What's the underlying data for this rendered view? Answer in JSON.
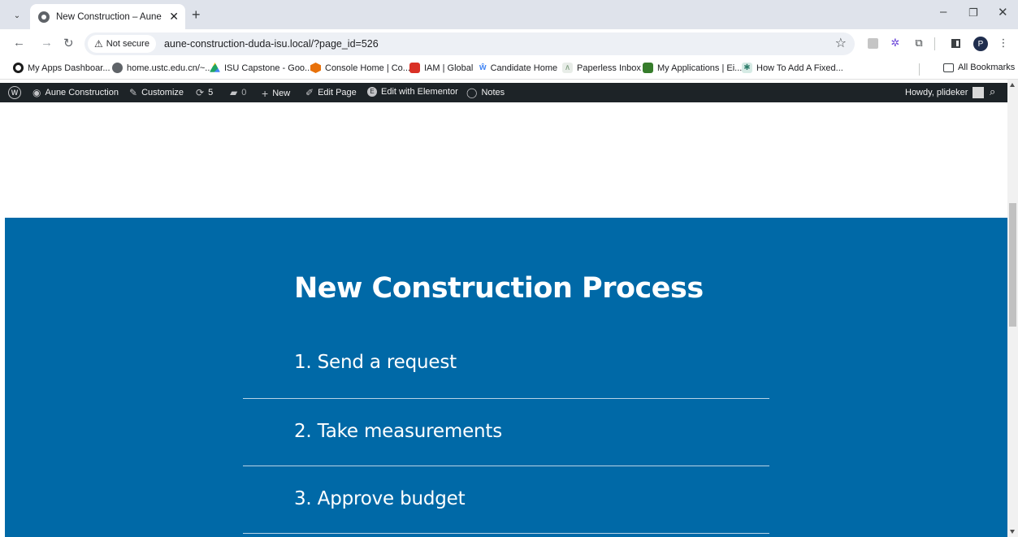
{
  "browser": {
    "tab_title": "New Construction – Aune Cons",
    "not_secure_label": "Not secure",
    "url": "aune-construction-duda-isu.local/?page_id=526",
    "profile_initial": "P"
  },
  "bookmarks": [
    {
      "label": "My Apps Dashboar...",
      "color": "#1a1a1a"
    },
    {
      "label": "home.ustc.edu.cn/~...",
      "color": "#5f6368"
    },
    {
      "label": "ISU Capstone - Goo...",
      "color": "#1fa463"
    },
    {
      "label": "Console Home | Co...",
      "color": "#e8710a"
    },
    {
      "label": "IAM | Global",
      "color": "#d93025"
    },
    {
      "label": "Candidate Home",
      "color": "#4285f4"
    },
    {
      "label": "Paperless Inbox",
      "color": "#7a9a7a"
    },
    {
      "label": "My Applications | Ei...",
      "color": "#367c2b"
    },
    {
      "label": "How To Add A Fixed...",
      "color": "#2e7d6b"
    }
  ],
  "all_bookmarks_label": "All Bookmarks",
  "wpbar": {
    "site_name": "Aune Construction",
    "customize": "Customize",
    "updates_count": "5",
    "comments_count": "0",
    "new": "New",
    "edit_page": "Edit Page",
    "edit_elementor": "Edit with Elementor",
    "notes": "Notes",
    "howdy": "Howdy, plideker"
  },
  "page": {
    "heading": "New Construction Process",
    "steps": [
      "1. Send a request",
      "2. Take measurements",
      "3. Approve budget"
    ],
    "hero_color": "#0069a7"
  }
}
